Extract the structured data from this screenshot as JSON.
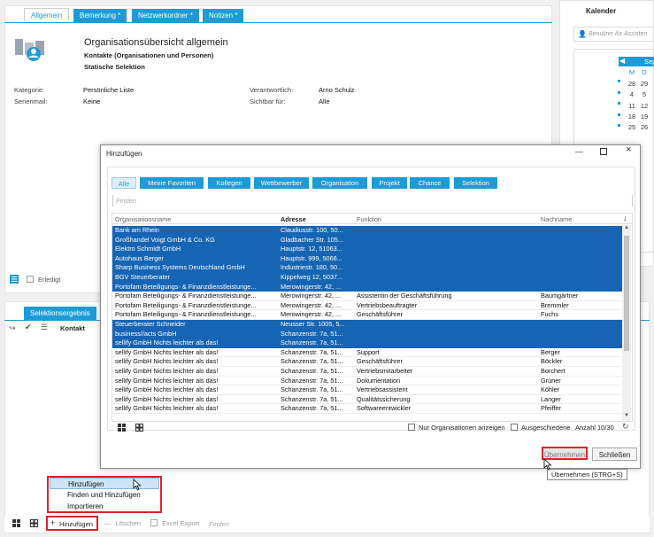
{
  "main": {
    "tabs": [
      {
        "label": "Allgemein"
      },
      {
        "label": "Bemerkung *"
      },
      {
        "label": "Netzwerkordner *"
      },
      {
        "label": "Notizen *"
      }
    ],
    "title": "Organisationsübersicht allgemein",
    "subtitle1": "Kontakte (Organisationen und Personen)",
    "subtitle2": "Statische Selektion",
    "fields": {
      "kategorie_label": "Kategorie:",
      "kategorie_value": "Persönliche Liste",
      "serienmail_label": "Serienmail:",
      "serienmail_value": "Keine",
      "verantwortlich_label": "Verantwortlich:",
      "verantwortlich_value": "Arno Schulz",
      "sichtbar_label": "Sichtbar für:",
      "sichtbar_value": "Alle"
    },
    "erledigt_label": "Erledigt"
  },
  "calendar": {
    "title": "Kalender",
    "user_placeholder": "Benutzer für Assisten",
    "month": "Sep",
    "weekday_headers": [
      "M",
      "D"
    ],
    "weeks": [
      {
        "kw": "",
        "d1": "",
        "d2": ""
      },
      {
        "kw": "",
        "d1": "28",
        "d2": "29"
      },
      {
        "kw": "",
        "d1": "4",
        "d2": "5"
      },
      {
        "kw": "",
        "d1": "11",
        "d2": "12"
      },
      {
        "kw": "",
        "d1": "18",
        "d2": "19"
      },
      {
        "kw": "",
        "d1": "25",
        "d2": "26"
      }
    ]
  },
  "selection_panel": {
    "tab": "Selektionsergebnis",
    "column_contact": "Kontakt"
  },
  "context_menu": {
    "items": [
      "Hinzufügen",
      "Finden und Hinzufügen",
      "Importieren"
    ]
  },
  "bottom_toolbar": {
    "add": "Hinzufügen",
    "delete": "Löschen",
    "excel": "Excel Export",
    "find": "Finden"
  },
  "dialog": {
    "title": "Hinzufügen",
    "filters": [
      "Alle",
      "Meine Favoriten",
      "Kollegen",
      "Wettbewerber",
      "Organisation",
      "Projekt",
      "Chance",
      "Selektion"
    ],
    "search_placeholder": "Finden",
    "columns": [
      "Organisationsname",
      "Adresse",
      "Funktion",
      "Nachname"
    ],
    "rows": [
      {
        "org": "Bank am Rhein",
        "addr": "Claudiusstr. 100, 50...",
        "func": "",
        "name": "",
        "selected": true
      },
      {
        "org": "Großhandel Voigt GmbH & Co. KG",
        "addr": "Gladbacher Str. 105...",
        "func": "",
        "name": "",
        "selected": true
      },
      {
        "org": "Elektro Schmidt GmbH",
        "addr": "Hauptstr. 12, 51063...",
        "func": "",
        "name": "",
        "selected": true
      },
      {
        "org": "Autohaus Berger",
        "addr": "Hauptstr. 999, 5066...",
        "func": "",
        "name": "",
        "selected": true
      },
      {
        "org": "Sharp Business Systems Deutschland GmbH",
        "addr": "Industriestr. 180, 50...",
        "func": "",
        "name": "",
        "selected": true
      },
      {
        "org": "BGV Steuerberater",
        "addr": "Kippelweg 12, 5037...",
        "func": "",
        "name": "",
        "selected": true
      },
      {
        "org": "Portofam Beteiligungs- & Finanzdienstleistunge...",
        "addr": "Merowingerstr. 42, ...",
        "func": "",
        "name": "",
        "selected": true
      },
      {
        "org": "Portofam Beteiligungs- & Finanzdienstleistunge...",
        "addr": "Merowingerstr. 42, ...",
        "func": "Assistentin der Geschäftsführung",
        "name": "Baumgärtner",
        "selected": false
      },
      {
        "org": "Portofam Beteiligungs- & Finanzdienstleistunge...",
        "addr": "Merowingerstr. 42, ...",
        "func": "Vertriebsbeauftragter",
        "name": "Bremmler",
        "selected": false
      },
      {
        "org": "Portofam Beteiligungs- & Finanzdienstleistunge...",
        "addr": "Merowingerstr. 42, ...",
        "func": "Geschäftsführer",
        "name": "Fuchs",
        "selected": false
      },
      {
        "org": "Steuerberater Schneider",
        "addr": "Neusser Str. 1005, 5...",
        "func": "",
        "name": "",
        "selected": true
      },
      {
        "org": "business//acts GmbH",
        "addr": "Schanzenstr. 7a, 51...",
        "func": "",
        "name": "",
        "selected": true
      },
      {
        "org": "sellify GmbH Nichts leichter als das!",
        "addr": "Schanzenstr. 7a, 51...",
        "func": "",
        "name": "",
        "selected": true
      },
      {
        "org": "sellify GmbH Nichts leichter als das!",
        "addr": "Schanzenstr. 7a, 51...",
        "func": "Support",
        "name": "Berger",
        "selected": false
      },
      {
        "org": "sellify GmbH Nichts leichter als das!",
        "addr": "Schanzenstr. 7a, 51...",
        "func": "Geschäftsführer",
        "name": "Böckler",
        "selected": false
      },
      {
        "org": "sellify GmbH Nichts leichter als das!",
        "addr": "Schanzenstr. 7a, 51...",
        "func": "Vertriebsmitarbeiter",
        "name": "Borchert",
        "selected": false
      },
      {
        "org": "sellify GmbH Nichts leichter als das!",
        "addr": "Schanzenstr. 7a, 51...",
        "func": "Dokumentation",
        "name": "Grüner",
        "selected": false
      },
      {
        "org": "sellify GmbH Nichts leichter als das!",
        "addr": "Schanzenstr. 7a, 51...",
        "func": "Vertriebsassistent",
        "name": "Köhler",
        "selected": false
      },
      {
        "org": "sellify GmbH Nichts leichter als das!",
        "addr": "Schanzenstr. 7a, 51...",
        "func": "Qualitätssicherung",
        "name": "Langer",
        "selected": false
      },
      {
        "org": "sellify GmbH Nichts leichter als das!",
        "addr": "Schanzenstr. 7a, 51...",
        "func": "Softwareentwickler",
        "name": "Pfeiffer",
        "selected": false
      }
    ],
    "only_orgs_label": "Nur Organisationen anzeigen",
    "ausgeschiedene_label": "Ausgeschiedene",
    "count_label": "Anzahl 10/30",
    "apply_button": "Übernehmen",
    "close_button": "Schließen",
    "tooltip": "Übernehmen (STRG+S)"
  }
}
